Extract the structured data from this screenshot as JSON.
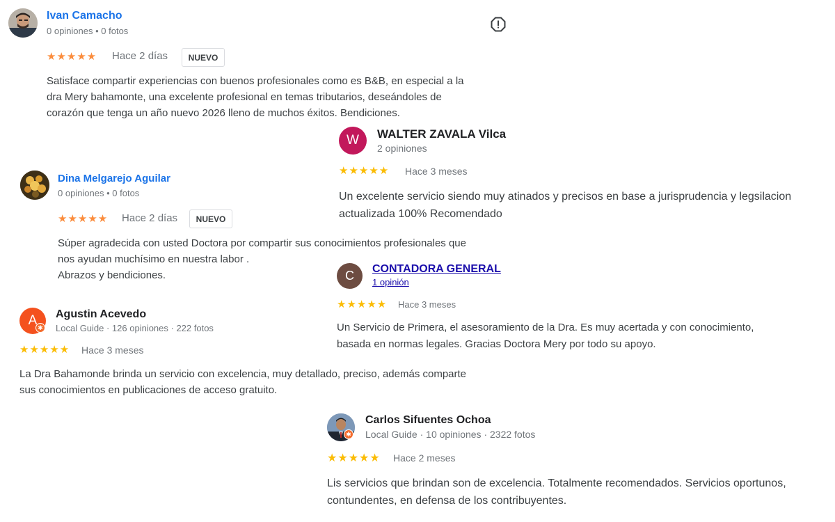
{
  "reviews": [
    {
      "author": "Ivan Camacho",
      "meta": "0 opiniones • 0 fotos",
      "stars": "★★★★★",
      "rating": 5,
      "date": "Hace 2 días",
      "tag": "NUEVO",
      "text_lines": [
        "Satisface compartir experiencias con buenos profesionales como es B&B, en especial a la",
        "dra Mery bahamonte, una excelente profesional en temas tributarios, deseándoles de",
        "corazón que tenga un año nuevo 2026 lleno de muchos éxitos. Bendiciones."
      ],
      "star_color": "#fb8c3c"
    },
    {
      "author": "WALTER ZAVALA Vilca",
      "meta": "2 opiniones",
      "avatar_letter": "W",
      "avatar_color": "#c2185b",
      "stars": "★★★★★",
      "rating": 5,
      "date": "Hace 3 meses",
      "text_lines": [
        "Un excelente servicio siendo muy atinados y precisos en base a jurisprudencia y legsilacion",
        "actualizada 100% Recomendado"
      ],
      "star_color": "#fbbc04"
    },
    {
      "author": "Dina Melgarejo Aguilar",
      "meta": "0 opiniones • 0 fotos",
      "stars": "★★★★★",
      "rating": 5,
      "date": "Hace 2 días",
      "tag": "NUEVO",
      "text_lines": [
        "Súper agradecida con usted Doctora por compartir sus conocimientos profesionales que",
        "nos ayudan muchísimo en nuestra labor .",
        "Abrazos y bendiciones."
      ],
      "star_color": "#fb8c3c"
    },
    {
      "author": "CONTADORA GENERAL",
      "meta": "1 opinión",
      "avatar_letter": "C",
      "avatar_color": "#6d4c41",
      "stars": "★★★★★",
      "rating": 5,
      "date": "Hace 3 meses",
      "text_lines": [
        "Un Servicio de Primera, el asesoramiento de la Dra. Es muy acertada y con conocimiento,",
        "basada en normas legales. Gracias Doctora Mery por todo su apoyo."
      ],
      "star_color": "#fbbc04"
    },
    {
      "author": "Agustin Acevedo",
      "meta": "Local Guide · 126 opiniones · 222 fotos",
      "avatar_letter": "A",
      "avatar_color": "#f4511e",
      "stars": "★★★★★",
      "rating": 5,
      "date": "Hace 3 meses",
      "text_lines": [
        "La Dra Bahamonde brinda un servicio con excelencia, muy detallado, preciso, además comparte",
        "sus conocimientos en publicaciones de acceso gratuito."
      ],
      "star_color": "#fbbc04"
    },
    {
      "author": "Carlos Sifuentes Ochoa",
      "meta": "Local Guide · 10 opiniones · 2322 fotos",
      "stars": "★★★★★",
      "rating": 5,
      "date": "Hace 2 meses",
      "text_lines": [
        "Lis servicios que brindan son de excelencia. Totalmente recomendados. Servicios oportunos,",
        "contundentes, en defensa de los contribuyentes."
      ],
      "star_color": "#fbbc04"
    }
  ],
  "icons": {
    "report": "exclamation-circle-icon",
    "local_guide_badge": "local-guide-badge-icon"
  }
}
